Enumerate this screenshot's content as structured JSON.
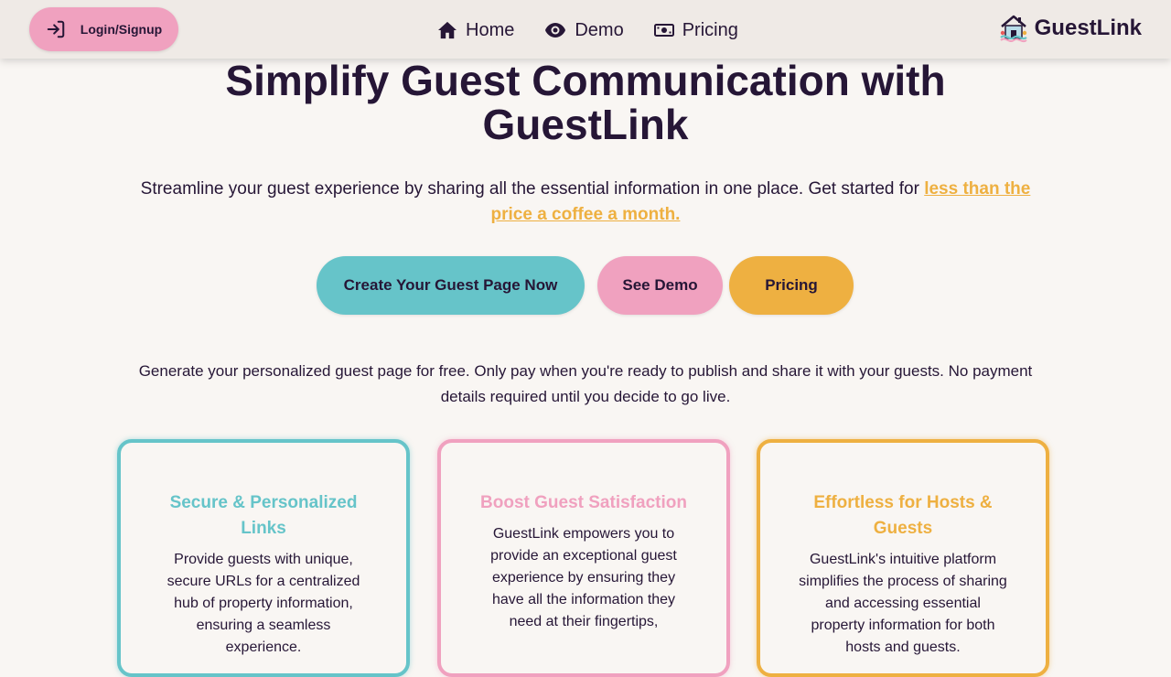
{
  "nav": {
    "login_label": "Login/Signup",
    "links": [
      {
        "label": "Home",
        "icon": "home-icon"
      },
      {
        "label": "Demo",
        "icon": "eye-icon"
      },
      {
        "label": "Pricing",
        "icon": "money-icon"
      }
    ],
    "brand": "GuestLink",
    "brand_icon": "house-logo-icon"
  },
  "hero": {
    "title": "Simplify Guest Communication with GuestLink",
    "subtitle": "Streamline your guest experience by sharing all the essential information in one place. Get started for",
    "subtitle_link": "less than the price a coffee a month."
  },
  "cta": {
    "create": "Create Your Guest Page Now",
    "demo": "See Demo",
    "pricing": "Pricing"
  },
  "note": "Generate your personalized guest page for free. Only pay when you're ready to publish and share it with your guests. No payment details required until you decide to go live.",
  "cards": [
    {
      "title": "Secure & Personalized Links",
      "text": "Provide guests with unique, secure URLs for a centralized hub of property information, ensuring a seamless experience."
    },
    {
      "title": "Boost Guest Satisfaction",
      "text": "GuestLink empowers you to provide an exceptional guest experience by ensuring they have all the information they need at their fingertips,"
    },
    {
      "title": "Effortless for Hosts & Guests",
      "text": "GuestLink's intuitive platform simplifies the process of sharing and accessing essential property information for both hosts and guests."
    }
  ],
  "colors": {
    "teal": "#66c4c9",
    "pink": "#f0a1bf",
    "gold": "#eeb041",
    "text": "#261636",
    "background": "#f9f6f3"
  }
}
